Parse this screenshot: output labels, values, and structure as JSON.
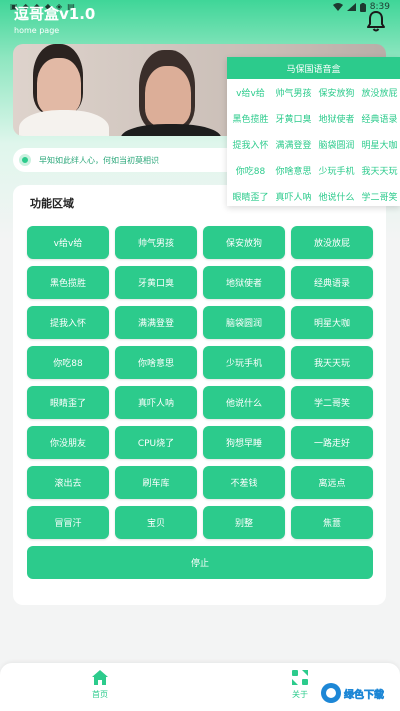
{
  "status_bar": {
    "time": "8:39",
    "left_icons": [
      "sim-icon",
      "notification-icon",
      "notification-icon",
      "notification-icon",
      "shield-icon",
      "download-icon"
    ],
    "right_icons": [
      "wifi-icon",
      "signal-icon",
      "battery-icon"
    ]
  },
  "header": {
    "title": "逗哥盒v1.0",
    "subtitle": "home page",
    "bell_icon": "bell-icon"
  },
  "notice": {
    "text": "早知如此绊人心，何如当初莫相识"
  },
  "popup": {
    "title": "马保国语音盒",
    "items": [
      "v给v给",
      "帅气男孩",
      "保安放狗",
      "放没放屁",
      "黑色揽胜",
      "牙黄口臭",
      "地狱使者",
      "经典语录",
      "提我入怀",
      "满满登登",
      "脑袋圆润",
      "明星大咖",
      "你吃88",
      "你啥意思",
      "少玩手机",
      "我天天玩",
      "眼睛歪了",
      "真吓人呐",
      "他说什么",
      "学二哥笑"
    ]
  },
  "main": {
    "title": "功能区域",
    "buttons": [
      "v给v给",
      "帅气男孩",
      "保安放狗",
      "放没放屁",
      "黑色揽胜",
      "牙黄口臭",
      "地狱使者",
      "经典语录",
      "提我入怀",
      "满满登登",
      "脑袋圆润",
      "明星大咖",
      "你吃88",
      "你啥意思",
      "少玩手机",
      "我天天玩",
      "眼睛歪了",
      "真吓人呐",
      "他说什么",
      "学二哥笑",
      "你没朋友",
      "CPU烧了",
      "狗想早睡",
      "一路走好",
      "滚出去",
      "刷车库",
      "不差钱",
      "离远点",
      "冒冒汗",
      "宝贝",
      "别整",
      "焦薏"
    ],
    "stop_label": "停止"
  },
  "bottom_nav": {
    "items": [
      {
        "label": "首页",
        "icon": "home-icon"
      },
      {
        "label": "关于",
        "icon": "about-icon"
      }
    ]
  },
  "watermark": {
    "text": "绿色下载"
  },
  "colors": {
    "accent": "#2ccb8c",
    "accent_light": "#c9f1df",
    "header_gradient_top": "#3fd698",
    "background": "#f3f4f4"
  }
}
